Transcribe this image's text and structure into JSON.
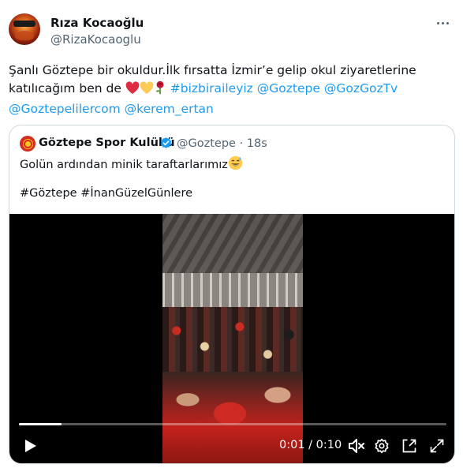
{
  "author": {
    "name": "Rıza Kocaoğlu",
    "handle": "@RizaKocaoglu"
  },
  "tweet": {
    "line1": "Şanlı Göztepe bir okuldur.İlk fırsatta  İzmir’e gelip okul ziyaretlerine",
    "line2_text": "katılıcağım ben de ",
    "emojis": [
      "red-heart-icon",
      "yellow-heart-icon",
      "rose-icon"
    ],
    "line2_links": [
      "#bizbiraileyiz",
      "@Goztepe",
      "@GozGozTv"
    ],
    "line3_links": [
      "@Goztepelilercom",
      "@kerem_ertan"
    ]
  },
  "quote": {
    "name": "Göztepe Spor Kulübü",
    "handle": "@Goztepe",
    "time": "· 18s",
    "text1": "Golün ardından minik taraftarlarımız",
    "text1_emoji": "grinning-sweat-face-icon",
    "text2": "#Göztepe #İnanGüzelGünlere"
  },
  "video": {
    "current_time": "0:01",
    "duration": "0:10",
    "time_display": "0:01 / 0:10",
    "progress_fraction": 0.1,
    "controls": [
      "play-icon",
      "mute-icon",
      "settings-icon",
      "pip-icon",
      "fullscreen-icon"
    ]
  },
  "colors": {
    "link": "#1d9bf0",
    "secondary_text": "#536471",
    "border": "#cfd9de",
    "verified": "#1d9bf0"
  }
}
